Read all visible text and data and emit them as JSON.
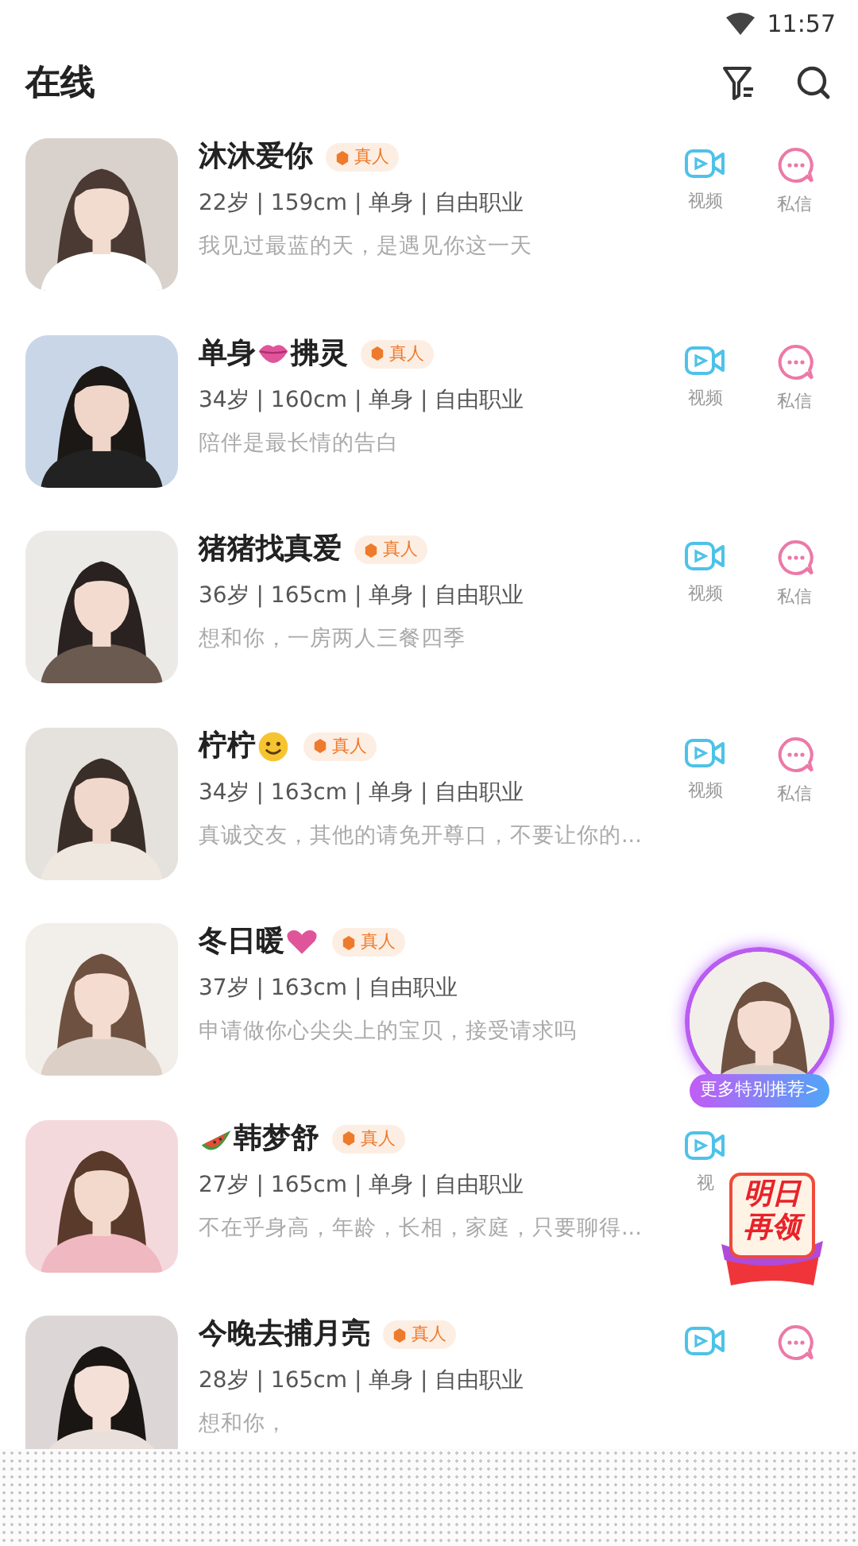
{
  "status_bar": {
    "time": "11:57"
  },
  "header": {
    "title": "在线"
  },
  "users": [
    {
      "name_parts": [
        {
          "kind": "text",
          "text": "沐沐爱你"
        }
      ],
      "tag": "真人",
      "meta": "22岁 | 159cm | 单身 | 自由职业",
      "bio": "我见过最蓝的天，是遇见你这一天",
      "photo": {
        "kind": "picture"
      },
      "actions": [
        {
          "kind": "video",
          "label": "视频"
        },
        {
          "kind": "message",
          "label": "私信"
        }
      ]
    },
    {
      "name_parts": [
        {
          "kind": "text",
          "text": "单身"
        },
        {
          "kind": "lips"
        },
        {
          "kind": "text",
          "text": "拂灵"
        }
      ],
      "tag": "真人",
      "meta": "34岁 | 160cm | 单身 | 自由职业",
      "bio": "陪伴是最长情的告白",
      "photo": {
        "kind": "picture"
      },
      "actions": [
        {
          "kind": "video",
          "label": "视频"
        },
        {
          "kind": "message",
          "label": "私信"
        }
      ]
    },
    {
      "name_parts": [
        {
          "kind": "text",
          "text": "猪猪找真爱"
        }
      ],
      "tag": "真人",
      "meta": "36岁 | 165cm | 单身 | 自由职业",
      "bio": "想和你，一房两人三餐四季",
      "photo": {
        "kind": "picture"
      },
      "actions": [
        {
          "kind": "video",
          "label": "视频"
        },
        {
          "kind": "message",
          "label": "私信"
        }
      ]
    },
    {
      "name_parts": [
        {
          "kind": "text",
          "text": "柠柠"
        },
        {
          "kind": "smile"
        }
      ],
      "tag": "真人",
      "meta": "34岁 | 163cm | 单身 | 自由职业",
      "bio": "真诚交友，其他的请免开尊口，不要让你的...",
      "photo": {
        "kind": "picture"
      },
      "actions": [
        {
          "kind": "video",
          "label": "视频"
        },
        {
          "kind": "message",
          "label": "私信"
        }
      ]
    },
    {
      "name_parts": [
        {
          "kind": "text",
          "text": "冬日暖"
        },
        {
          "kind": "heart"
        }
      ],
      "tag": "真人",
      "meta": "37岁 | 163cm | 自由职业",
      "bio": "申请做你心尖尖上的宝贝，接受请求吗",
      "photo": {
        "kind": "picture"
      }
    },
    {
      "name_parts": [
        {
          "kind": "watermelon"
        },
        {
          "kind": "text",
          "text": "韩梦舒"
        }
      ],
      "tag": "真人",
      "meta": "27岁 | 165cm | 单身 | 自由职业",
      "bio": "不在乎身高，年龄，长相，家庭，只要聊得...",
      "photo": {
        "kind": "picture"
      },
      "actions": [
        {
          "kind": "video",
          "label": "视"
        }
      ]
    },
    {
      "name_parts": [
        {
          "kind": "text",
          "text": "今晚去捕月亮"
        }
      ],
      "tag": "真人",
      "meta": "28岁 | 165cm | 单身 | 自由职业",
      "bio": "想和你，",
      "photo": {
        "kind": "picture"
      },
      "actions": [
        {
          "kind": "video"
        },
        {
          "kind": "message"
        }
      ]
    }
  ],
  "recommend": {
    "photo": {
      "kind": "picture"
    },
    "label": "更多特别推荐>"
  },
  "reward_badge": {
    "line_1": "明日",
    "line_2": "再领"
  }
}
